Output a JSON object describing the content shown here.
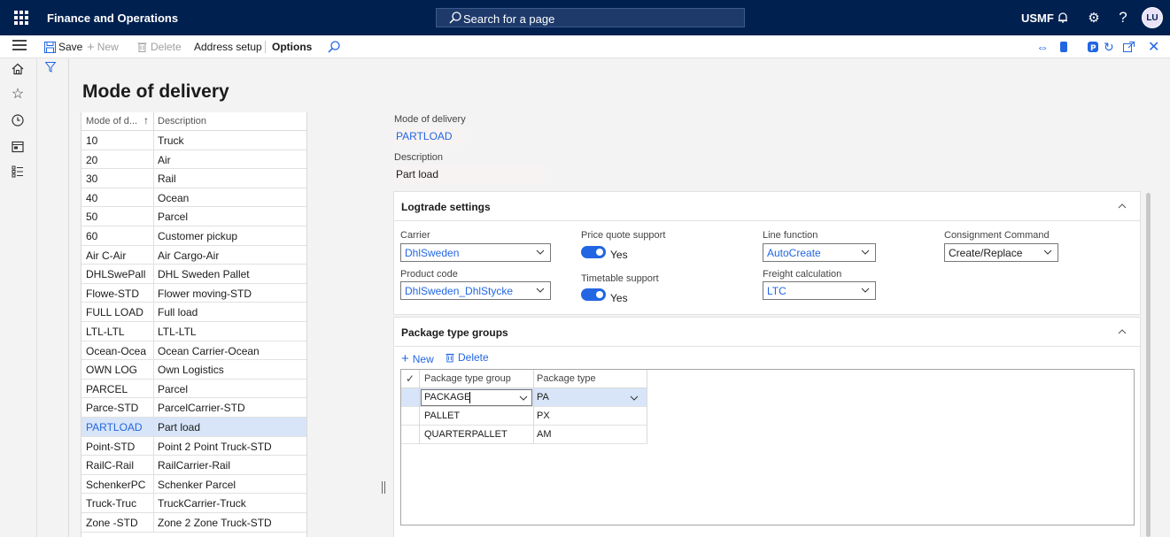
{
  "topbar": {
    "app_title": "Finance and Operations",
    "search_placeholder": "Search for a page",
    "company": "USMF",
    "user_initials": "LU"
  },
  "actions": {
    "save": "Save",
    "new": "New",
    "delete": "Delete",
    "address_setup": "Address setup",
    "options": "Options"
  },
  "page_title": "Mode of delivery",
  "list": {
    "col1": "Mode of d...",
    "col2": "Description",
    "rows": [
      {
        "code": "10",
        "desc": "Truck"
      },
      {
        "code": "20",
        "desc": "Air"
      },
      {
        "code": "30",
        "desc": "Rail"
      },
      {
        "code": "40",
        "desc": "Ocean"
      },
      {
        "code": "50",
        "desc": "Parcel"
      },
      {
        "code": "60",
        "desc": "Customer pickup"
      },
      {
        "code": "Air C-Air",
        "desc": "Air Cargo-Air"
      },
      {
        "code": "DHLSwePall",
        "desc": "DHL Sweden Pallet"
      },
      {
        "code": "Flowe-STD",
        "desc": "Flower moving-STD"
      },
      {
        "code": "FULL LOAD",
        "desc": "Full load"
      },
      {
        "code": "LTL-LTL",
        "desc": "LTL-LTL"
      },
      {
        "code": "Ocean-Ocea",
        "desc": "Ocean Carrier-Ocean"
      },
      {
        "code": "OWN LOG",
        "desc": "Own Logistics"
      },
      {
        "code": "PARCEL",
        "desc": "Parcel"
      },
      {
        "code": "Parce-STD",
        "desc": "ParcelCarrier-STD"
      },
      {
        "code": "PARTLOAD",
        "desc": "Part load"
      },
      {
        "code": "Point-STD",
        "desc": "Point 2 Point Truck-STD"
      },
      {
        "code": "RailC-Rail",
        "desc": "RailCarrier-Rail"
      },
      {
        "code": "SchenkerPC",
        "desc": "Schenker Parcel"
      },
      {
        "code": "Truck-Truc",
        "desc": "TruckCarrier-Truck"
      },
      {
        "code": "Zone -STD",
        "desc": "Zone 2 Zone Truck-STD"
      }
    ]
  },
  "details": {
    "mode_label": "Mode of delivery",
    "mode_value": "PARTLOAD",
    "desc_label": "Description",
    "desc_value": "Part load"
  },
  "logtrade": {
    "title": "Logtrade settings",
    "carrier_label": "Carrier",
    "carrier_value": "DhlSweden",
    "product_label": "Product code",
    "product_value": "DhlSweden_DhlStycke",
    "price_label": "Price quote support",
    "price_value": "Yes",
    "timetable_label": "Timetable support",
    "timetable_value": "Yes",
    "line_label": "Line function",
    "line_value": "AutoCreate",
    "freight_label": "Freight calculation",
    "freight_value": "LTC",
    "consignment_label": "Consignment Command",
    "consignment_value": "Create/Replace"
  },
  "packages": {
    "title": "Package type groups",
    "new": "New",
    "delete": "Delete",
    "col1": "Package type group",
    "col2": "Package type",
    "rows": [
      {
        "group": "PACKAGE",
        "type": "PA"
      },
      {
        "group": "PALLET",
        "type": "PX"
      },
      {
        "group": "QUARTERPALLET",
        "type": "AM"
      }
    ]
  }
}
